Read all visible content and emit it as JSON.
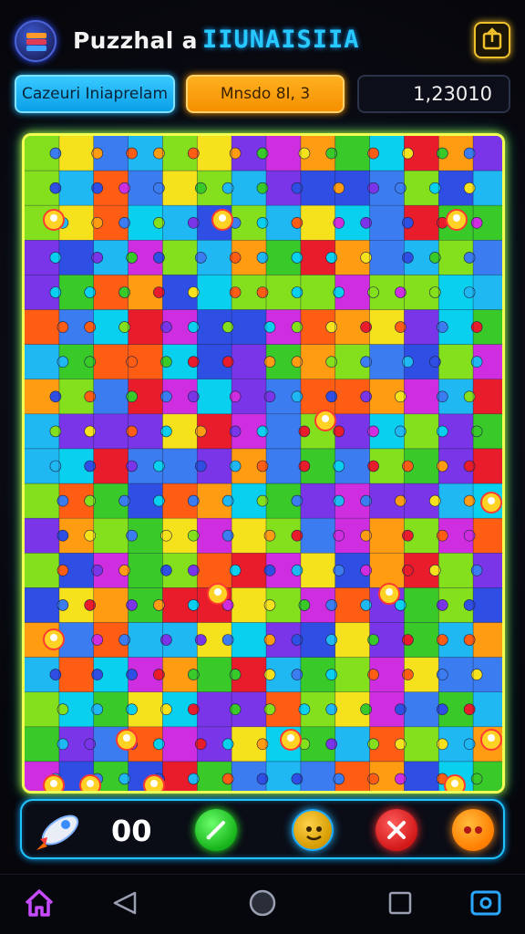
{
  "header": {
    "title": "Puzzhal a",
    "subtitle": "IIUNAISIIA",
    "logo_icon": "layered-puzzle-logo-icon",
    "share_icon": "share-icon"
  },
  "status": {
    "blue_label": "Cazeuri Iniaprelam",
    "orange_label": "Mnsdo 8I, 3",
    "score": "1,23010"
  },
  "board": {
    "palette": [
      "#7a35e8",
      "#3b7cf0",
      "#1fb8f2",
      "#0ad0f0",
      "#39c928",
      "#84e01c",
      "#f6e21c",
      "#ff9c12",
      "#ff5d14",
      "#e81c2a",
      "#cf2ee0",
      "#2f4ee4"
    ],
    "grid_color": "#1b2040",
    "sticker_colors": {
      "red": "#ff3b30",
      "white": "#ffffff",
      "yellow": "#ffd226"
    }
  },
  "toolbar": {
    "moves": "00",
    "rocket_icon": "rocket-icon",
    "hint_icon": "pencil-hint-icon",
    "mascot_icon": "mascot-face-icon",
    "close_icon": "close-x-icon",
    "menu_icon": "more-dots-icon"
  },
  "navbar": {
    "home_icon": "home-icon",
    "back_icon": "back-triangle-icon",
    "home_circle_icon": "home-circle-icon",
    "recent_icon": "recent-square-icon",
    "screenshot_icon": "screenshot-icon"
  },
  "colors": {
    "accent_blue": "#1ec3ff",
    "accent_yellow": "#f0ff52",
    "accent_orange": "#ff9d00"
  }
}
